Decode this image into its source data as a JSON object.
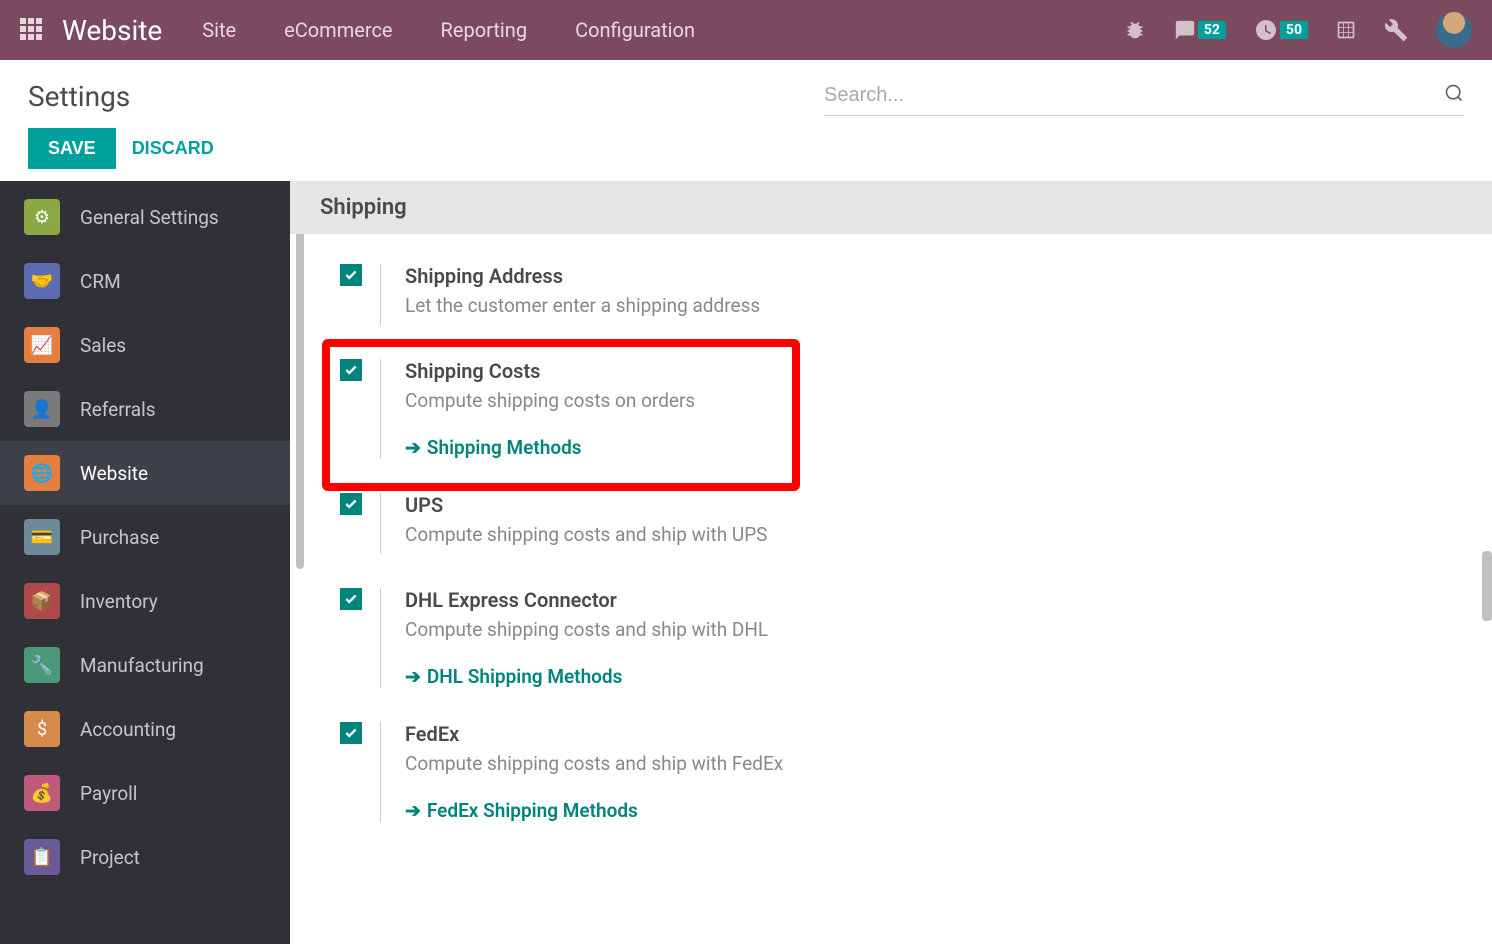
{
  "topnav": {
    "brand": "Website",
    "menu": [
      "Site",
      "eCommerce",
      "Reporting",
      "Configuration"
    ],
    "messages_count": "52",
    "activities_count": "50"
  },
  "header": {
    "title": "Settings",
    "search_placeholder": "Search...",
    "save_label": "SAVE",
    "discard_label": "DISCARD"
  },
  "sidebar": {
    "items": [
      {
        "label": "General Settings"
      },
      {
        "label": "CRM"
      },
      {
        "label": "Sales"
      },
      {
        "label": "Referrals"
      },
      {
        "label": "Website"
      },
      {
        "label": "Purchase"
      },
      {
        "label": "Inventory"
      },
      {
        "label": "Manufacturing"
      },
      {
        "label": "Accounting"
      },
      {
        "label": "Payroll"
      },
      {
        "label": "Project"
      }
    ]
  },
  "content": {
    "section_title": "Shipping",
    "settings": [
      {
        "title": "Shipping Address",
        "desc": "Let the customer enter a shipping address",
        "link": null
      },
      {
        "title": "Shipping Costs",
        "desc": "Compute shipping costs on orders",
        "link": "Shipping Methods"
      },
      {
        "title": "UPS",
        "desc": "Compute shipping costs and ship with UPS",
        "link": null
      },
      {
        "title": "DHL Express Connector",
        "desc": "Compute shipping costs and ship with DHL",
        "link": "DHL Shipping Methods"
      },
      {
        "title": "FedEx",
        "desc": "Compute shipping costs and ship with FedEx",
        "link": "FedEx Shipping Methods"
      }
    ]
  }
}
